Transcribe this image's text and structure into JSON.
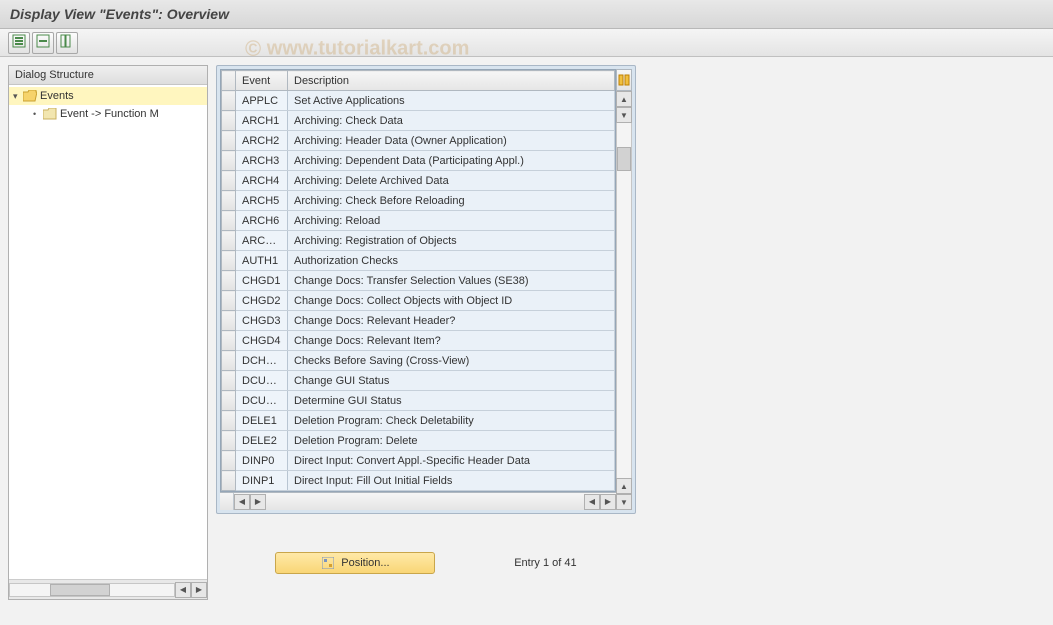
{
  "title": "Display View \"Events\": Overview",
  "watermark": "www.tutorialkart.com",
  "toolbar": {
    "btn1_icon": "expand-all-icon",
    "btn2_icon": "collapse-all-icon",
    "btn3_icon": "columns-icon"
  },
  "tree": {
    "header": "Dialog Structure",
    "nodes": [
      {
        "label": "Events",
        "selected": true,
        "open": true,
        "indent": 1
      },
      {
        "label": "Event -> Function M",
        "selected": false,
        "open": false,
        "indent": 2
      }
    ]
  },
  "table": {
    "columns": {
      "event": "Event",
      "description": "Description"
    },
    "rows": [
      {
        "code": "APPLC",
        "desc": "Set Active Applications"
      },
      {
        "code": "ARCH1",
        "desc": "Archiving: Check Data"
      },
      {
        "code": "ARCH2",
        "desc": "Archiving: Header Data (Owner Application)"
      },
      {
        "code": "ARCH3",
        "desc": "Archiving: Dependent Data (Participating Appl.)"
      },
      {
        "code": "ARCH4",
        "desc": "Archiving: Delete Archived Data"
      },
      {
        "code": "ARCH5",
        "desc": "Archiving: Check Before Reloading"
      },
      {
        "code": "ARCH6",
        "desc": "Archiving: Reload"
      },
      {
        "code": "ARCHR",
        "desc": "Archiving: Registration of Objects"
      },
      {
        "code": "AUTH1",
        "desc": "Authorization Checks"
      },
      {
        "code": "CHGD1",
        "desc": "Change Docs: Transfer Selection Values (SE38)"
      },
      {
        "code": "CHGD2",
        "desc": "Change Docs: Collect Objects with Object ID"
      },
      {
        "code": "CHGD3",
        "desc": "Change Docs: Relevant Header?"
      },
      {
        "code": "CHGD4",
        "desc": "Change Docs: Relevant Item?"
      },
      {
        "code": "DCHCK",
        "desc": "Checks Before Saving (Cross-View)"
      },
      {
        "code": "DCUAC",
        "desc": "Change GUI Status"
      },
      {
        "code": "DCUAD",
        "desc": "Determine GUI Status"
      },
      {
        "code": "DELE1",
        "desc": "Deletion Program: Check Deletability"
      },
      {
        "code": "DELE2",
        "desc": "Deletion Program: Delete"
      },
      {
        "code": "DINP0",
        "desc": "Direct Input: Convert Appl.-Specific Header Data"
      },
      {
        "code": "DINP1",
        "desc": "Direct Input: Fill Out Initial Fields"
      }
    ]
  },
  "footer": {
    "position_label": "Position...",
    "entry_info": "Entry 1 of 41"
  }
}
